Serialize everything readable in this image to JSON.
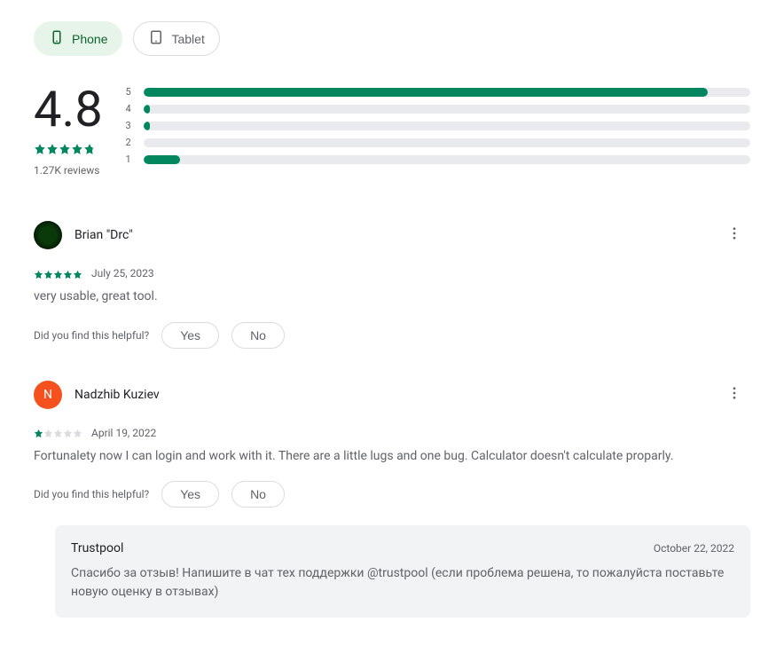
{
  "tabs": {
    "phone": "Phone",
    "tablet": "Tablet"
  },
  "summary": {
    "score": "4.8",
    "reviews": "1.27K reviews",
    "bars": [
      {
        "label": "5",
        "pct": 93
      },
      {
        "label": "4",
        "pct": 1
      },
      {
        "label": "3",
        "pct": 1
      },
      {
        "label": "2",
        "pct": 0
      },
      {
        "label": "1",
        "pct": 6
      }
    ]
  },
  "reviews": [
    {
      "user": "Brian \"Drc\"",
      "avatar_bg": "radial-gradient(circle, #0a3a0a 40%, #000 100%)",
      "avatar_letter": "",
      "avatar_color": "#000",
      "rating": 5,
      "date": "July 25, 2023",
      "text": "very usable, great tool.",
      "helpful": "Did you find this helpful?",
      "yes": "Yes",
      "no": "No"
    },
    {
      "user": "Nadzhib Kuziev",
      "avatar_bg": "#f4511e",
      "avatar_letter": "N",
      "avatar_color": "#f4511e",
      "rating": 1,
      "date": "April 19, 2022",
      "text": "Fortunalety now I can login and work with it. There are a little lugs and one bug. Calculator doesn't calculate proparly.",
      "helpful": "Did you find this helpful?",
      "yes": "Yes",
      "no": "No",
      "response": {
        "name": "Trustpool",
        "date": "October 22, 2022",
        "text": "Спасибо за отзыв! Напишите в чат тех поддержки @trustpool (если проблема решена, то пожалуйста поставьте новую оценку в отзывах)"
      }
    }
  ]
}
